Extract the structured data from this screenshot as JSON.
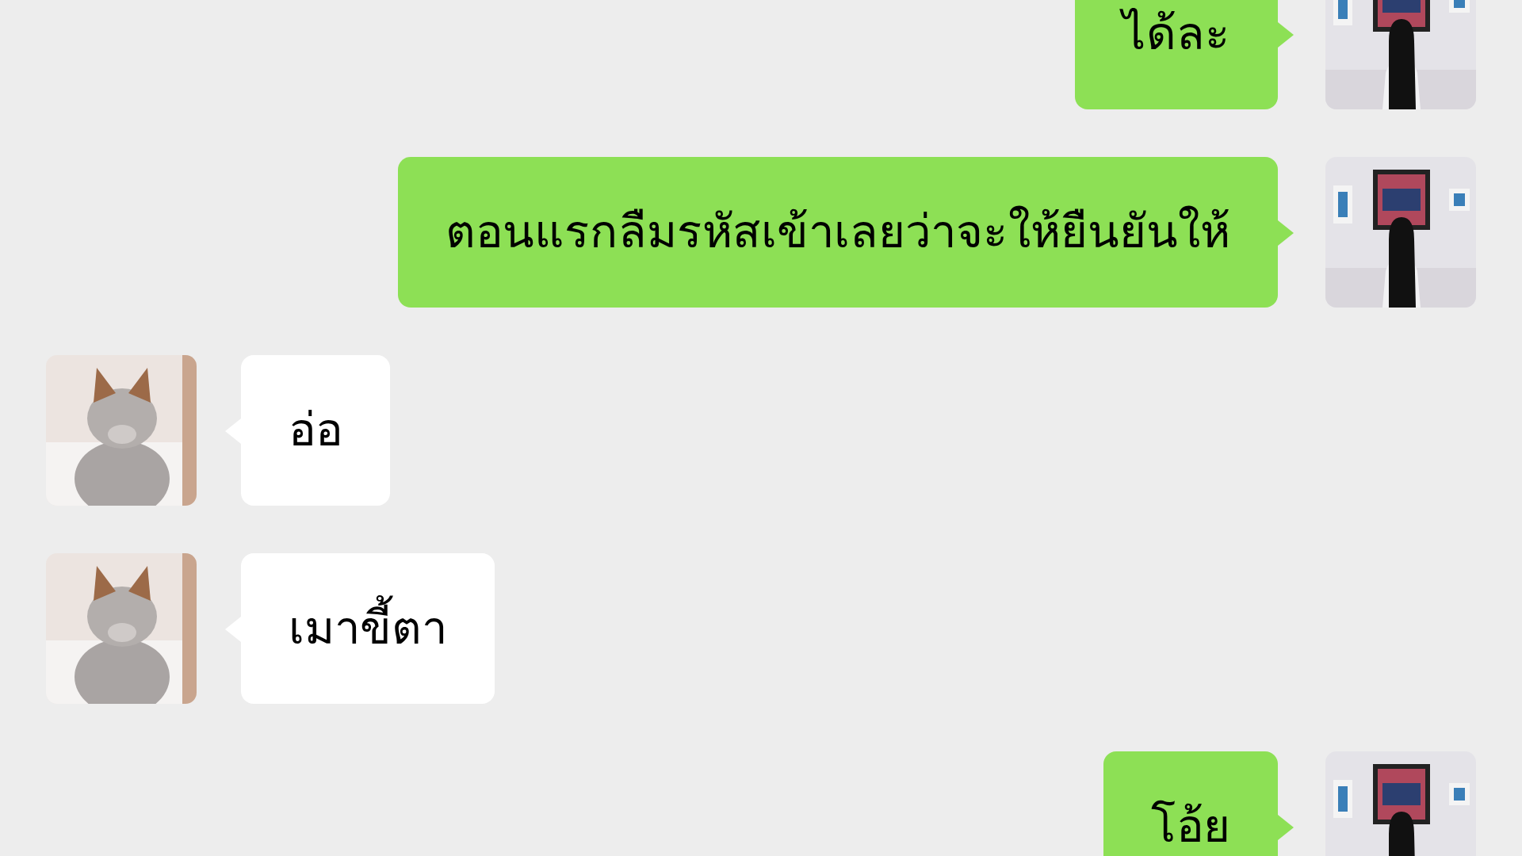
{
  "messages": [
    {
      "kind": "sent",
      "text": "ได้ละ"
    },
    {
      "kind": "sent",
      "text": "ตอนแรกลืมรหัสเข้าเลยว่าจะให้ยืนยันให้"
    },
    {
      "kind": "received",
      "text": "อ่อ"
    },
    {
      "kind": "received",
      "text": "เมาขี้ตา"
    },
    {
      "kind": "sent",
      "text": "โอ้ย"
    }
  ]
}
